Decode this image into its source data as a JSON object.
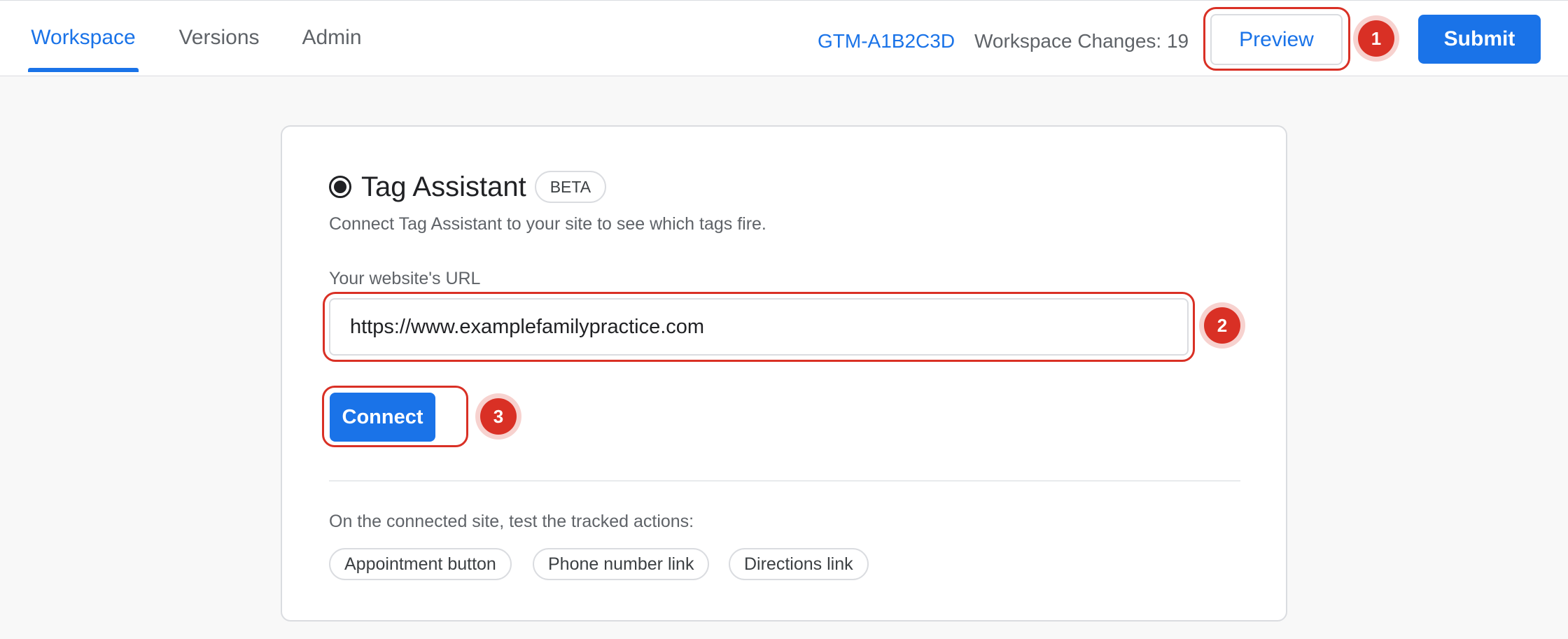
{
  "header": {
    "tabs": [
      {
        "label": "Workspace",
        "active": true
      },
      {
        "label": "Versions",
        "active": false
      },
      {
        "label": "Admin",
        "active": false
      }
    ],
    "container_id": "GTM-A1B2C3D",
    "workspace_changes": "Workspace Changes: 19",
    "preview_label": "Preview",
    "submit_label": "Submit"
  },
  "tag_assistant": {
    "title": "Tag Assistant",
    "badge": "BETA",
    "description": "Connect Tag Assistant to your site to see which tags fire.",
    "url_label": "Your website's URL",
    "url_value": "https://www.examplefamilypractice.com",
    "connect_label": "Connect",
    "test_prompt": "On the connected site, test the tracked actions:",
    "tracked_actions": [
      "Appointment button",
      "Phone number link",
      "Directions link"
    ]
  },
  "annotations": {
    "step1": "1",
    "step2": "2",
    "step3": "3"
  },
  "colors": {
    "accent": "#1a73e8",
    "highlight": "#d93025",
    "card_border": "#dadce0",
    "page_background": "#f8f8f8"
  },
  "icons": {
    "title_icon": "radio-selected-icon"
  }
}
